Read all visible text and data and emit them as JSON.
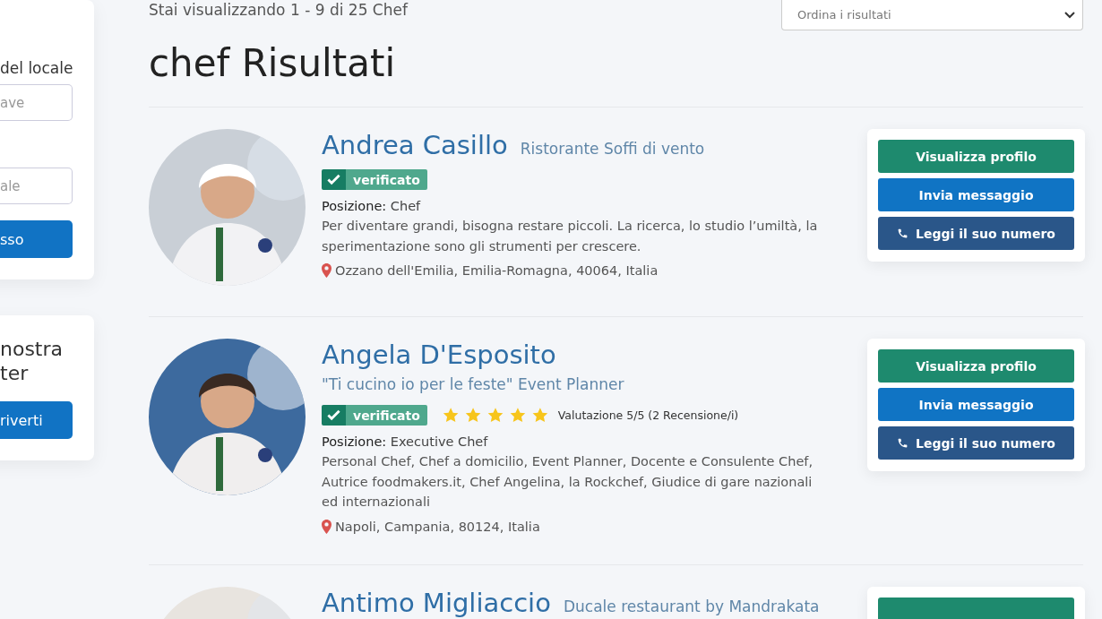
{
  "sidebar": {
    "search_card": {
      "label": "del locale",
      "fields": [
        {
          "placeholder": "ave"
        },
        {
          "placeholder": "ale"
        }
      ],
      "button": "sso"
    },
    "newsletter_card": {
      "heading_lines": [
        "nostra",
        "ter"
      ],
      "button": "riverti"
    }
  },
  "header": {
    "count_text": "Stai visualizzando 1 - 9 di 25 Chef",
    "sort_select": {
      "placeholder": "Ordina i risultati"
    }
  },
  "title": "chef Risultati",
  "chefs": [
    {
      "name": "Andrea Casillo",
      "subtitle": "Ristorante Soffi di vento",
      "verified": true,
      "verified_label": "verificato",
      "position_label": "Posizione:",
      "position": "Chef",
      "bio": "Per diventare grandi, bisogna restare piccoli. La ricerca, lo studio l’umiltà, la sperimentazione sono gli strumenti per crescere.",
      "location": "Ozzano dell'Emilia, Emilia-Romagna, 40064, Italia",
      "actions": [
        {
          "kind": "profile",
          "label": "Visualizza profilo"
        },
        {
          "kind": "message",
          "label": "Invia messaggio"
        },
        {
          "kind": "phone",
          "label": "Leggi il suo numero"
        }
      ]
    },
    {
      "name": "Angela D'Esposito",
      "subtitle": "\"Ti cucino io per le feste\" Event Planner",
      "verified": true,
      "verified_label": "verificato",
      "stars": 5,
      "rating_text": "Valutazione 5/5 (2 Recensione/i)",
      "position_label": "Posizione:",
      "position": "Executive Chef",
      "bio": "Personal Chef, Chef a domicilio, Event Planner, Docente e Consulente Chef, Autrice foodmakers.it, Chef Angelina, la Rockchef, Giudice di gare nazionali ed internazionali",
      "location": "Napoli, Campania, 80124, Italia",
      "actions": [
        {
          "kind": "profile",
          "label": "Visualizza profilo"
        },
        {
          "kind": "message",
          "label": "Invia messaggio"
        },
        {
          "kind": "phone",
          "label": "Leggi il suo numero"
        }
      ]
    },
    {
      "name": "Antimo Migliaccio",
      "subtitle": "Ducale restaurant by Mandrakata",
      "actions": [
        {
          "kind": "profile"
        }
      ]
    }
  ]
}
